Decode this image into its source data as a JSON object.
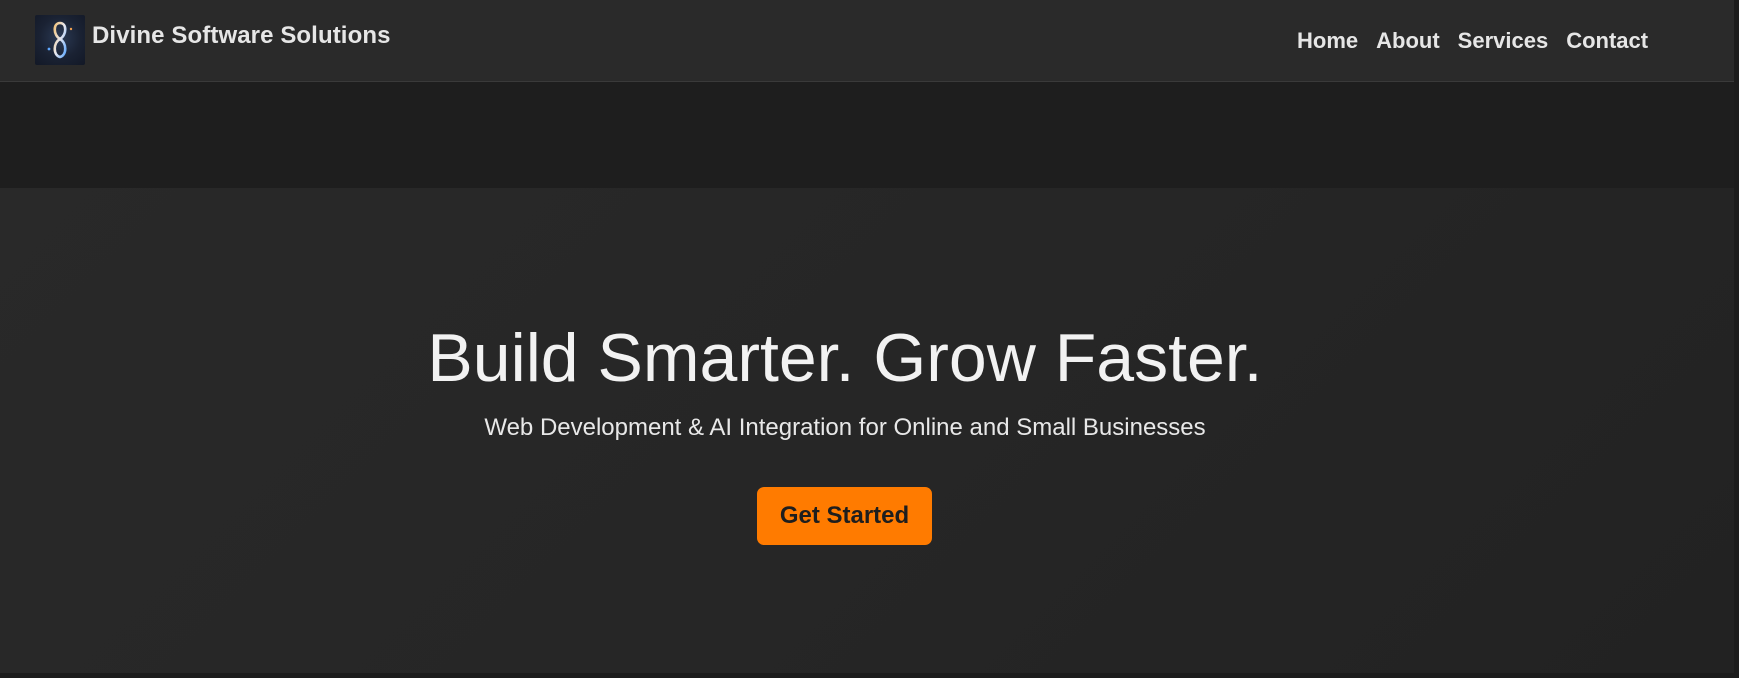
{
  "header": {
    "brand_name": "Divine Software Solutions",
    "logo_icon": "infinity-logo-icon",
    "nav": [
      {
        "label": "Home"
      },
      {
        "label": "About"
      },
      {
        "label": "Services"
      },
      {
        "label": "Contact"
      }
    ]
  },
  "hero": {
    "title": "Build Smarter. Grow Faster.",
    "subtitle": "Web Development & AI Integration for Online and Small Businesses",
    "cta_label": "Get Started"
  },
  "colors": {
    "accent": "#ff7b00",
    "navbar_bg": "#2a2a2a",
    "page_bg": "#1e1e1e",
    "text": "#e6e6e6"
  }
}
